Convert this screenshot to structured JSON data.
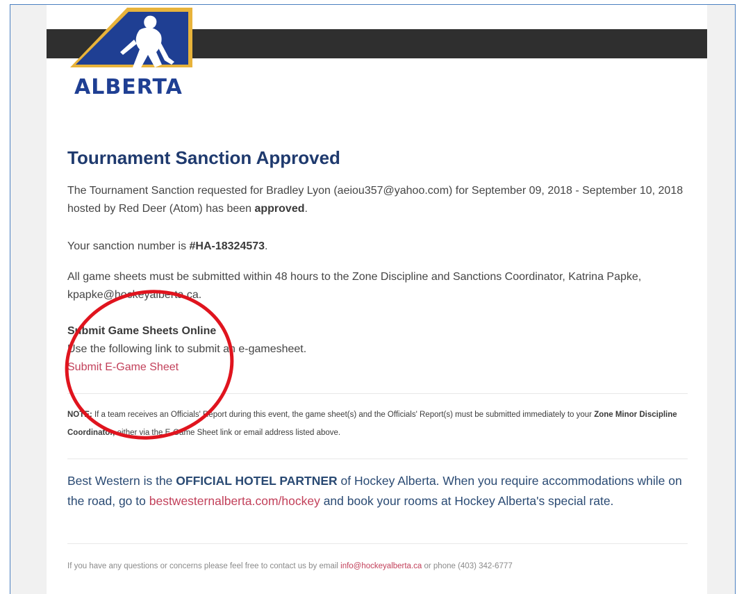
{
  "logo": {
    "text": "ALBERTA",
    "colors": {
      "blue": "#1f3f93",
      "gold": "#e8b33a"
    }
  },
  "heading": "Tournament Sanction Approved",
  "intro": {
    "text": "The Tournament Sanction requested for Bradley Lyon (aeiou357@yahoo.com) for September 09, 2018 - September 10, 2018 hosted by Red Deer (Atom) has been ",
    "bold": "approved",
    "end": "."
  },
  "sanction": {
    "prefix": "Your sanction number is ",
    "number": "#HA-18324573",
    "end": "."
  },
  "game_sheets": {
    "text": "All game sheets must be submitted within 48 hours to the Zone Discipline and Sanctions Coordinator, Katrina Papke, kpapke@hockeyalberta.ca."
  },
  "submit": {
    "title": "Submit Game Sheets Online",
    "desc": "Use the following link to submit an e-gamesheet.",
    "link": "Submit E-Game Sheet"
  },
  "note": {
    "label": "NOTE:",
    "text": " If a team receives an Officials' Report during this event, the game sheet(s) and the Officials' Report(s) must be submitted immediately to your ",
    "bold": "Zone Minor Discipline Coordinator,",
    "end": " either via the E-Game Sheet link or email address listed above."
  },
  "partner": {
    "text1": "Best Western is the ",
    "bold": "OFFICIAL HOTEL PARTNER",
    "text2": " of Hockey Alberta. When you require accommodations while on the road, go to ",
    "link": "bestwesternalberta.com/hockey",
    "text3": " and book your rooms at Hockey Alberta's special rate."
  },
  "footer": {
    "text1": "If you have any questions or concerns please feel free to contact us by email ",
    "email": "info@hockeyalberta.ca",
    "text2": " or phone (403) 342-6777"
  },
  "annotation": {
    "color": "#e0141e"
  }
}
